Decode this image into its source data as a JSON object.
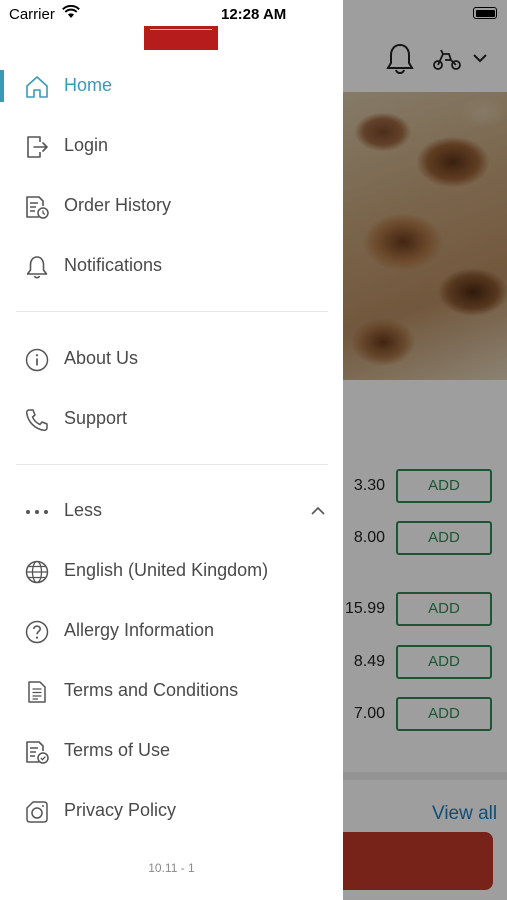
{
  "status_bar": {
    "carrier": "Carrier",
    "time": "12:28 AM"
  },
  "menu": {
    "primary": [
      {
        "label": "Home",
        "icon": "home-icon",
        "active": true
      },
      {
        "label": "Login",
        "icon": "login-icon"
      },
      {
        "label": "Order History",
        "icon": "order-history-icon"
      },
      {
        "label": "Notifications",
        "icon": "bell-icon"
      }
    ],
    "secondary": [
      {
        "label": "About Us",
        "icon": "info-icon"
      },
      {
        "label": "Support",
        "icon": "phone-icon"
      }
    ],
    "more": {
      "label": "Less",
      "items": [
        {
          "label": "English (United Kingdom)",
          "icon": "globe-icon"
        },
        {
          "label": "Allergy Information",
          "icon": "question-circle-icon"
        },
        {
          "label": "Terms and Conditions",
          "icon": "document-icon"
        },
        {
          "label": "Terms of Use",
          "icon": "document-check-icon"
        },
        {
          "label": "Privacy Policy",
          "icon": "privacy-icon"
        }
      ]
    },
    "version": "10.11 - 1"
  },
  "background": {
    "prices": [
      {
        "price": "3.30",
        "button": "ADD"
      },
      {
        "price": "8.00",
        "button": "ADD"
      },
      {
        "price": "15.99",
        "button": "ADD"
      },
      {
        "price": "8.49",
        "button": "ADD"
      },
      {
        "price": "7.00",
        "button": "ADD"
      }
    ],
    "view_all": "View all"
  },
  "colors": {
    "accent": "#3a9ab5",
    "text": "#4a4a4a",
    "add_button": "#2e8b57",
    "brand": "#b71c1c",
    "link": "#1a7fc1"
  }
}
